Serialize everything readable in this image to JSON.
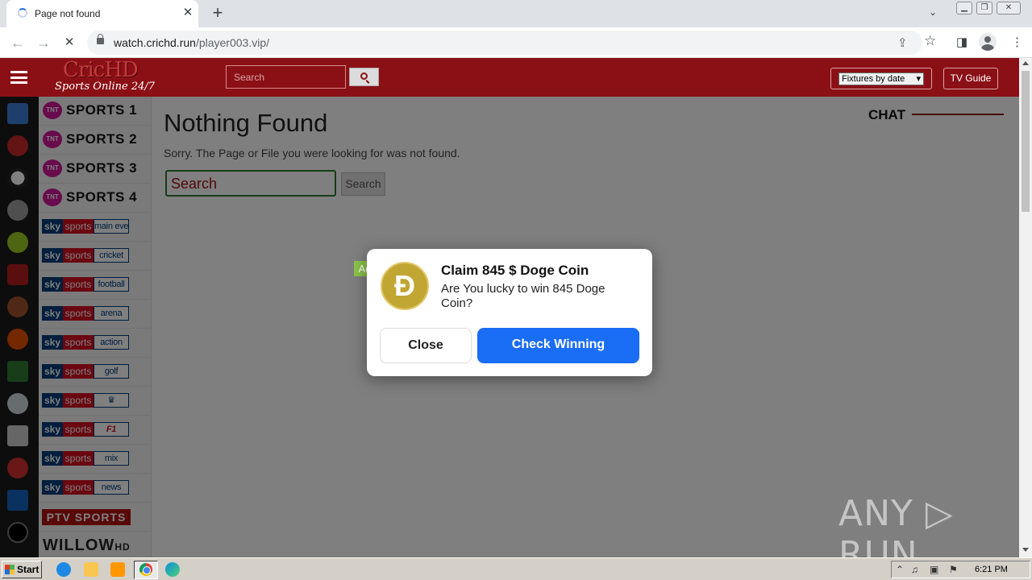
{
  "browser": {
    "tab_title": "Page not found",
    "tab_close": "✕",
    "new_tab": "+",
    "url_host": "watch.crichd.run",
    "url_path": "/player003.vip/",
    "back": "←",
    "forward": "→",
    "reload": "✕"
  },
  "site": {
    "logo_main": "CricHD",
    "logo_sub": "Sports Online 24/7",
    "search_placeholder": "Search",
    "fixtures_label": "Fixtures by date",
    "tvguide_label": "TV Guide",
    "chat_label": "CHAT"
  },
  "channels": {
    "tnt": [
      "SPORTS 1",
      "SPORTS 2",
      "SPORTS 3",
      "SPORTS 4"
    ],
    "tnt_badge": "TNT",
    "sky_a": "sky",
    "sky_b": "sports",
    "sky": [
      "main event",
      "cricket",
      "football",
      "arena",
      "action",
      "golf",
      "",
      "F1",
      "mix",
      "news"
    ],
    "ptv": "PTV SPORTS",
    "willow": "WILLOW",
    "willow_hd": "HD"
  },
  "main": {
    "title": "Nothing Found",
    "message": "Sorry. The Page or File you were looking for was not found.",
    "search_value": "Search",
    "search_button": "Search"
  },
  "ad": {
    "tag": "Ad",
    "coin_symbol": "Ð",
    "title": "Claim 845 $ Doge Coin",
    "body": "Are You lucky to win 845 Doge Coin?",
    "close_label": "Close",
    "check_label": "Check Winning"
  },
  "watermark": "ANY ▷ RUN",
  "taskbar": {
    "start_label": "Start",
    "clock": "6:21 PM"
  },
  "colors": {
    "header": "#8b1016",
    "ad_button": "#1a6df5",
    "ad_tag": "#8bc34a",
    "doge": "#c2a633"
  }
}
